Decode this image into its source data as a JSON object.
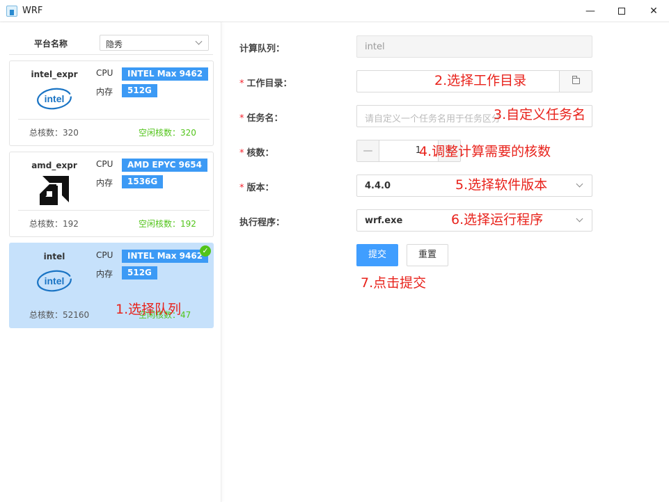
{
  "window": {
    "title": "WRF",
    "minimize_glyph": "—",
    "close_glyph": "✕"
  },
  "sidebar": {
    "platform_label": "平台名称",
    "platform_value": "隐秀",
    "cards": [
      {
        "name": "intel_expr",
        "logo": "intel-logo",
        "cpu_label": "CPU",
        "cpu_value": "INTEL Max 9462",
        "mem_label": "内存",
        "mem_value": "512G",
        "total_cores": "总核数：320",
        "free_cores": "空闲核数：320",
        "selected": false
      },
      {
        "name": "amd_expr",
        "logo": "amd-logo",
        "cpu_label": "CPU",
        "cpu_value": "AMD EPYC 9654",
        "mem_label": "内存",
        "mem_value": "1536G",
        "total_cores": "总核数：192",
        "free_cores": "空闲核数：192",
        "selected": false
      },
      {
        "name": "intel",
        "logo": "intel-logo",
        "cpu_label": "CPU",
        "cpu_value": "INTEL Max 9462",
        "mem_label": "内存",
        "mem_value": "512G",
        "total_cores": "总核数：52160",
        "free_cores": "空闲核数：47",
        "selected": true
      }
    ],
    "intel_logo_text": "intel"
  },
  "form": {
    "queue": {
      "label": "计算队列：",
      "value": "intel"
    },
    "workdir": {
      "required": "*",
      "label": "工作目录：",
      "value": ""
    },
    "taskname": {
      "required": "*",
      "label": "任务名：",
      "placeholder": "请自定义一个任务名用于任务区分"
    },
    "cores": {
      "required": "*",
      "label": "核数：",
      "value": "1",
      "minus": "—",
      "plus": "+"
    },
    "version": {
      "required": "*",
      "label": "版本：",
      "value": "4.4.0"
    },
    "program": {
      "label": "执行程序：",
      "value": "wrf.exe"
    },
    "submit_label": "提交",
    "reset_label": "重置"
  },
  "annotations": {
    "step1": "1.选择队列",
    "step2": "2.选择工作目录",
    "step3": "3.自定义任务名",
    "step4": "4.调整计算需要的核数",
    "step5": "5.选择软件版本",
    "step6": "6.选择运行程序",
    "step7": "7.点击提交"
  },
  "colors": {
    "accent": "#409eff",
    "badge": "#3c9af5",
    "selected_card": "#c6e1fb",
    "free_green": "#52c41a",
    "annotation_red": "#e8221b",
    "required_red": "#f5222d"
  }
}
